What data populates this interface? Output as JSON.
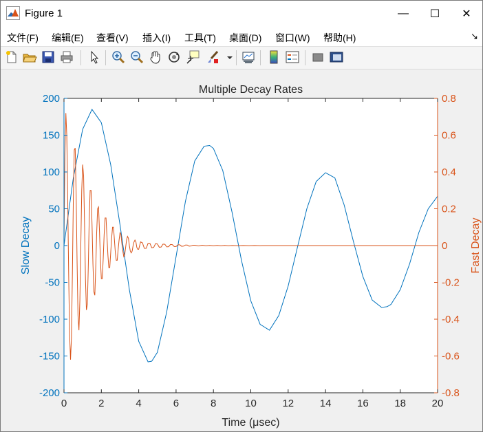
{
  "window": {
    "title": "Figure 1",
    "minimize_glyph": "—",
    "maximize_glyph": "☐",
    "close_glyph": "✕"
  },
  "menu": {
    "items": [
      "文件(F)",
      "编辑(E)",
      "查看(V)",
      "插入(I)",
      "工具(T)",
      "桌面(D)",
      "窗口(W)",
      "帮助(H)"
    ],
    "overflow_glyph": "↘"
  },
  "toolbar": {
    "icons": [
      "new-figure-icon",
      "open-file-icon",
      "save-icon",
      "print-icon",
      "pointer-icon",
      "zoom-in-icon",
      "zoom-out-icon",
      "pan-hand-icon",
      "rotate-3d-icon",
      "data-cursor-icon",
      "brush-icon",
      "brush-dropdown-icon",
      "link-plot-icon",
      "colorbar-icon",
      "legend-icon",
      "hide-plot-tools-icon",
      "show-plot-tools-icon"
    ]
  },
  "colors": {
    "slow": "#0072bd",
    "fast": "#d95319",
    "axes": "#262626",
    "bg": "#ffffff"
  },
  "chart_data": {
    "type": "line",
    "title": "Multiple Decay Rates",
    "xlabel": "Time (μsec)",
    "xlim": [
      0,
      20
    ],
    "xticks": [
      0,
      2,
      4,
      6,
      8,
      10,
      12,
      14,
      16,
      18,
      20
    ],
    "xtick_labels": [
      "0",
      "2",
      "4",
      "6",
      "8",
      "10",
      "12",
      "14",
      "16",
      "18",
      "20"
    ],
    "y_left": {
      "label": "Slow Decay",
      "lim": [
        -200,
        200
      ],
      "ticks": [
        -200,
        -150,
        -100,
        -50,
        0,
        50,
        100,
        150,
        200
      ],
      "tick_labels": [
        "-200",
        "-150",
        "-100",
        "-50",
        "0",
        "50",
        "100",
        "150",
        "200"
      ]
    },
    "y_right": {
      "label": "Fast Decay",
      "lim": [
        -0.8,
        0.8
      ],
      "ticks": [
        -0.8,
        -0.6,
        -0.4,
        -0.2,
        0,
        0.2,
        0.4,
        0.6,
        0.8
      ],
      "tick_labels": [
        "-0.8",
        "-0.6",
        "-0.4",
        "-0.2",
        "0",
        "0.2",
        "0.4",
        "0.6",
        "0.8"
      ]
    },
    "grid": false,
    "series": [
      {
        "axis": "left",
        "x": [
          0,
          0.5,
          1.0,
          1.5,
          2.0,
          2.5,
          3.0,
          3.5,
          4.0,
          4.5,
          4.7,
          5.0,
          5.5,
          6.0,
          6.5,
          7.0,
          7.5,
          7.8,
          8.0,
          8.5,
          9.0,
          9.5,
          10.0,
          10.5,
          11.0,
          11.5,
          12.0,
          12.5,
          13.0,
          13.5,
          14.0,
          14.5,
          15.0,
          15.5,
          16.0,
          16.5,
          17.0,
          17.3,
          17.5,
          18.0,
          18.5,
          19.0,
          19.5,
          20.0
        ],
        "y": [
          0,
          92,
          158,
          185,
          167,
          110,
          28,
          -60,
          -130,
          -158,
          -157,
          -145,
          -90,
          -15,
          60,
          115,
          135,
          136,
          132,
          102,
          45,
          -20,
          -75,
          -107,
          -115,
          -95,
          -55,
          -2,
          50,
          87,
          99,
          92,
          55,
          5,
          -42,
          -74,
          -84,
          -83,
          -80,
          -60,
          -25,
          18,
          50,
          67
        ]
      },
      {
        "axis": "right",
        "x": [
          0,
          0.05,
          0.1,
          0.15,
          0.2,
          0.25,
          0.3,
          0.35,
          0.4,
          0.45,
          0.5,
          0.55,
          0.6,
          0.65,
          0.7,
          0.75,
          0.8,
          0.85,
          0.9,
          0.95,
          1.0,
          1.05,
          1.1,
          1.15,
          1.2,
          1.25,
          1.3,
          1.35,
          1.4,
          1.45,
          1.5,
          1.55,
          1.6,
          1.65,
          1.7,
          1.75,
          1.8,
          1.85,
          1.9,
          1.95,
          2.0,
          2.05,
          2.1,
          2.15,
          2.2,
          2.25,
          2.3,
          2.35,
          2.4,
          2.45,
          2.5,
          2.55,
          2.6,
          2.65,
          2.7,
          2.75,
          2.8,
          2.85,
          2.9,
          2.95,
          3.0,
          3.05,
          3.1,
          3.15,
          3.2,
          3.25,
          3.3,
          3.35,
          3.4,
          3.45,
          3.5,
          3.55,
          3.6,
          3.65,
          3.7,
          3.75,
          3.8,
          3.85,
          3.9,
          3.95,
          4.0,
          4.1,
          4.2,
          4.3,
          4.4,
          4.5,
          4.6,
          4.7,
          4.8,
          4.9,
          5.0,
          5.1,
          5.2,
          5.3,
          5.4,
          5.5,
          5.6,
          5.7,
          5.8,
          5.9,
          6.0,
          6.1,
          6.2,
          6.3,
          6.4,
          6.5,
          6.6,
          6.7,
          6.8,
          6.9,
          7.0,
          7.2,
          7.4,
          7.6,
          7.8,
          8.0,
          8.2,
          8.4,
          8.6,
          8.8,
          9.0,
          9.3,
          9.6,
          9.9,
          10.2,
          10.5,
          10.8,
          11.2,
          11.6,
          12.0,
          12.5,
          13.0,
          14.0,
          15.0,
          16.0,
          17.0,
          18.0,
          19.0,
          20.0
        ],
        "y": [
          0,
          0.5,
          0.72,
          0.6,
          0.25,
          -0.15,
          -0.48,
          -0.62,
          -0.5,
          -0.15,
          0.25,
          0.52,
          0.53,
          0.28,
          -0.08,
          -0.38,
          -0.46,
          -0.3,
          0.0,
          0.3,
          0.44,
          0.38,
          0.12,
          -0.18,
          -0.35,
          -0.32,
          -0.12,
          0.14,
          0.3,
          0.3,
          0.12,
          -0.1,
          -0.25,
          -0.27,
          -0.12,
          0.07,
          0.2,
          0.21,
          0.08,
          -0.08,
          -0.18,
          -0.18,
          -0.07,
          0.06,
          0.15,
          0.15,
          0.05,
          -0.05,
          -0.12,
          -0.12,
          -0.04,
          0.04,
          0.1,
          0.1,
          0.03,
          -0.04,
          -0.08,
          -0.08,
          -0.02,
          0.03,
          0.07,
          0.06,
          0.01,
          -0.03,
          -0.06,
          -0.05,
          -0.01,
          0.03,
          0.05,
          0.04,
          0.0,
          -0.03,
          -0.04,
          -0.03,
          0.0,
          0.02,
          0.03,
          0.02,
          -0.01,
          -0.02,
          -0.02,
          0.02,
          0.015,
          -0.015,
          -0.015,
          0.012,
          0.012,
          -0.012,
          -0.01,
          0.01,
          0.009,
          -0.009,
          -0.008,
          0.008,
          0.007,
          -0.007,
          -0.006,
          0.006,
          0.005,
          -0.005,
          -0.005,
          0.004,
          0.004,
          -0.004,
          -0.003,
          0.003,
          0.003,
          -0.003,
          -0.002,
          0.002,
          0.002,
          -0.002,
          0.002,
          -0.001,
          0.001,
          -0.001,
          0.001,
          -0.001,
          0.001,
          -0.001,
          0.0005,
          -0.0005,
          0.0004,
          -0.0004,
          0.0003,
          -0.0003,
          0.0002,
          -0.0002,
          0.0001,
          0,
          0,
          0,
          0,
          0,
          0,
          0,
          0,
          0,
          0
        ]
      }
    ]
  }
}
